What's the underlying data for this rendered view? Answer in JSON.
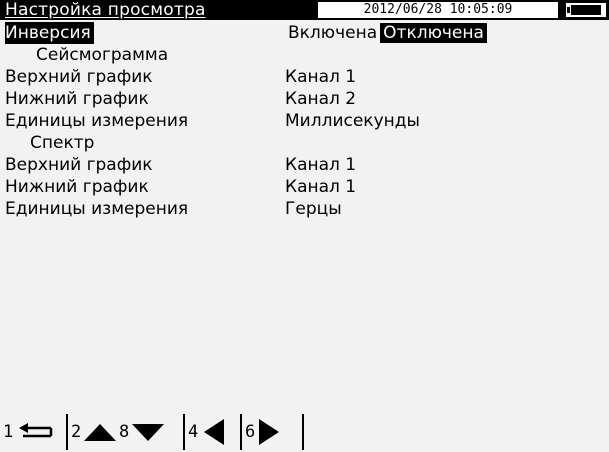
{
  "header": {
    "title": "Настройка просмотра",
    "datetime": "2012/06/28 10:05:09"
  },
  "rows": {
    "inversion": {
      "label": "Инверсия",
      "option_on": "Включена",
      "option_off": "Отключена",
      "selected": "Отключена"
    },
    "seismogram": {
      "heading": "Сейсмограмма",
      "top_label": "Верхний график",
      "top_value": "Канал 1",
      "bottom_label": "Нижний график",
      "bottom_value": "Канал 2",
      "units_label": "Единицы измерения",
      "units_value": "Миллисекунды"
    },
    "spectrum": {
      "heading": "Спектр",
      "top_label": "Верхний график",
      "top_value": "Канал 1",
      "bottom_label": "Нижний график",
      "bottom_value": "Канал 1",
      "units_label": "Единицы измерения",
      "units_value": "Герцы"
    }
  },
  "fkeys": [
    {
      "num": "1",
      "icon": "return-icon"
    },
    {
      "num": "2",
      "icon": "arrow-up-icon"
    },
    {
      "num": "8",
      "icon": "arrow-down-icon"
    },
    {
      "num": "4",
      "icon": "arrow-left-icon"
    },
    {
      "num": "6",
      "icon": "arrow-right-icon"
    }
  ],
  "colors": {
    "foreground": "#000000",
    "background": "#f2f2f2",
    "highlight": "#000000",
    "highlight_text": "#ffffff"
  }
}
